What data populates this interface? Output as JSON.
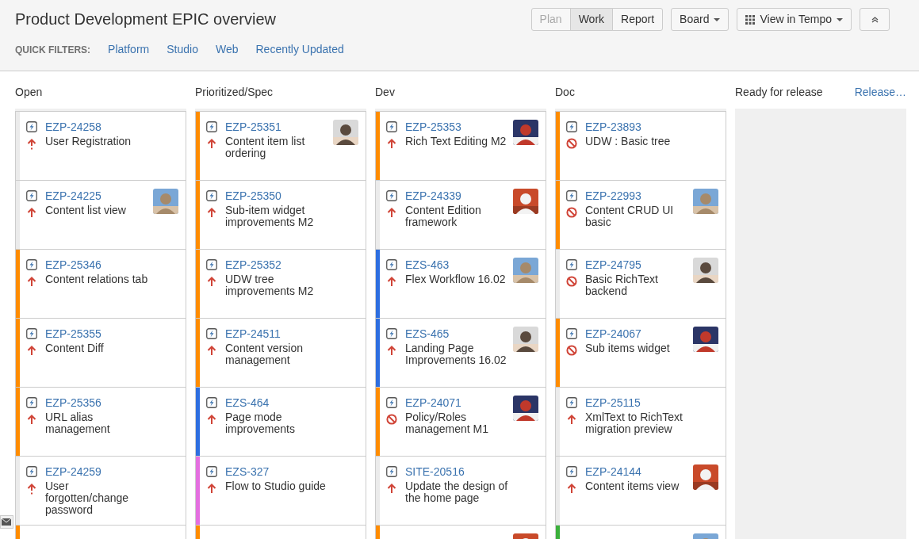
{
  "title": "Product Development EPIC overview",
  "modes": [
    {
      "label": "Plan",
      "selected": false,
      "disabled": true
    },
    {
      "label": "Work",
      "selected": true,
      "disabled": false
    },
    {
      "label": "Report",
      "selected": false,
      "disabled": false
    }
  ],
  "board_button": "Board",
  "tempo_button": "View in Tempo",
  "quick_filters": {
    "label": "QUICK FILTERS:",
    "filters": [
      "Platform",
      "Studio",
      "Web",
      "Recently Updated"
    ]
  },
  "columns": [
    {
      "name": "Open",
      "cards": [
        {
          "key": "EZP-24258",
          "summary": "User Registration",
          "kind": "critical",
          "color": "#ebebeb",
          "avatar": false
        },
        {
          "key": "EZP-24225",
          "summary": "Content list view",
          "kind": "major",
          "color": "#ebebeb",
          "avatar": true
        },
        {
          "key": "EZP-25346",
          "summary": "Content relations tab",
          "kind": "major",
          "color": "#ff8c00",
          "avatar": false
        },
        {
          "key": "EZP-25355",
          "summary": "Content Diff",
          "kind": "major",
          "color": "#ff8c00",
          "avatar": false
        },
        {
          "key": "EZP-25356",
          "summary": "URL alias management",
          "kind": "major",
          "color": "#ff8c00",
          "avatar": false
        },
        {
          "key": "EZP-24259",
          "summary": "User forgotten/change password",
          "kind": "critical",
          "color": "#ebebeb",
          "avatar": false
        }
      ],
      "partial_card": {
        "color": "#ff8c00",
        "avatar": false
      }
    },
    {
      "name": "Prioritized/Spec",
      "cards": [
        {
          "key": "EZP-25351",
          "summary": "Content item list ordering",
          "kind": "major",
          "color": "#ff8c00",
          "avatar": true
        },
        {
          "key": "EZP-25350",
          "summary": "Sub-item widget improvements M2",
          "kind": "major",
          "color": "#ff8c00",
          "avatar": false
        },
        {
          "key": "EZP-25352",
          "summary": "UDW tree improvements M2",
          "kind": "major",
          "color": "#ff8c00",
          "avatar": false
        },
        {
          "key": "EZP-24511",
          "summary": "Content version management",
          "kind": "major",
          "color": "#ff8c00",
          "avatar": false
        },
        {
          "key": "EZS-464",
          "summary": "Page mode improvements",
          "kind": "major",
          "color": "#2d6ee0",
          "avatar": false
        },
        {
          "key": "EZS-327",
          "summary": "Flow to Studio guide",
          "kind": "major",
          "color": "#e46fe0",
          "avatar": false
        }
      ],
      "partial_card": {
        "color": "#ff8c00",
        "avatar": false
      }
    },
    {
      "name": "Dev",
      "cards": [
        {
          "key": "EZP-25353",
          "summary": "Rich Text Editing M2",
          "kind": "major",
          "color": "#ff8c00",
          "avatar": true
        },
        {
          "key": "EZP-24339",
          "summary": "Content Edition framework",
          "kind": "major",
          "color": "#ebebeb",
          "avatar": true
        },
        {
          "key": "EZS-463",
          "summary": "Flex Workflow 16.02",
          "kind": "major",
          "color": "#2d6ee0",
          "avatar": true
        },
        {
          "key": "EZS-465",
          "summary": "Landing Page Improvements 16.02",
          "kind": "major",
          "color": "#2d6ee0",
          "avatar": true
        },
        {
          "key": "EZP-24071",
          "summary": "Policy/Roles management M1",
          "kind": "blocker",
          "color": "#ff8c00",
          "avatar": true
        },
        {
          "key": "SITE-20516",
          "summary": "Update the design of the home page",
          "kind": "major",
          "color": "#ebebeb",
          "avatar": false
        }
      ],
      "partial_card": {
        "color": "#ff8c00",
        "avatar": true
      }
    },
    {
      "name": "Doc",
      "cards": [
        {
          "key": "EZP-23893",
          "summary": "UDW : Basic tree",
          "kind": "blocker",
          "color": "#ff8c00",
          "avatar": false
        },
        {
          "key": "EZP-22993",
          "summary": "Content CRUD UI basic",
          "kind": "blocker",
          "color": "#ff8c00",
          "avatar": true
        },
        {
          "key": "EZP-24795",
          "summary": "Basic RichText backend",
          "kind": "blocker",
          "color": "#ebebeb",
          "avatar": true
        },
        {
          "key": "EZP-24067",
          "summary": "Sub items widget",
          "kind": "blocker",
          "color": "#ff8c00",
          "avatar": true
        },
        {
          "key": "EZP-25115",
          "summary": "XmlText to RichText migration preview",
          "kind": "major",
          "color": "#ebebeb",
          "avatar": false
        },
        {
          "key": "EZP-24144",
          "summary": "Content items view",
          "kind": "major",
          "color": "#ebebeb",
          "avatar": true
        }
      ],
      "partial_card": {
        "color": "#3bb03b",
        "avatar": true
      }
    },
    {
      "name": "Ready for release",
      "action": "Release…"
    }
  ]
}
